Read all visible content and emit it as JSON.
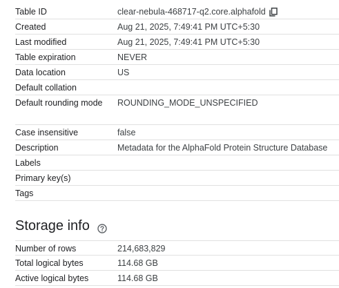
{
  "details": {
    "rows": [
      {
        "label": "Table ID",
        "value": "clear-nebula-468717-q2.core.alphafold"
      },
      {
        "label": "Created",
        "value": "Aug 21, 2025, 7:49:41 PM UTC+5:30"
      },
      {
        "label": "Last modified",
        "value": "Aug 21, 2025, 7:49:41 PM UTC+5:30"
      },
      {
        "label": "Table expiration",
        "value": "NEVER"
      },
      {
        "label": "Data location",
        "value": "US"
      },
      {
        "label": "Default collation",
        "value": ""
      },
      {
        "label": "Default rounding mode",
        "value": "ROUNDING_MODE_UNSPECIFIED"
      },
      {
        "label": "Case insensitive",
        "value": "false"
      },
      {
        "label": "Description",
        "value": "Metadata for the AlphaFold Protein Structure Database"
      },
      {
        "label": "Labels",
        "value": ""
      },
      {
        "label": "Primary key(s)",
        "value": ""
      },
      {
        "label": "Tags",
        "value": ""
      }
    ],
    "copy_icon": "copy-icon"
  },
  "storage": {
    "title": "Storage info",
    "help_icon": "help-circle-icon",
    "rows": [
      {
        "label": "Number of rows",
        "value": "214,683,829"
      },
      {
        "label": "Total logical bytes",
        "value": "114.68 GB"
      },
      {
        "label": "Active logical bytes",
        "value": "114.68 GB"
      }
    ]
  }
}
